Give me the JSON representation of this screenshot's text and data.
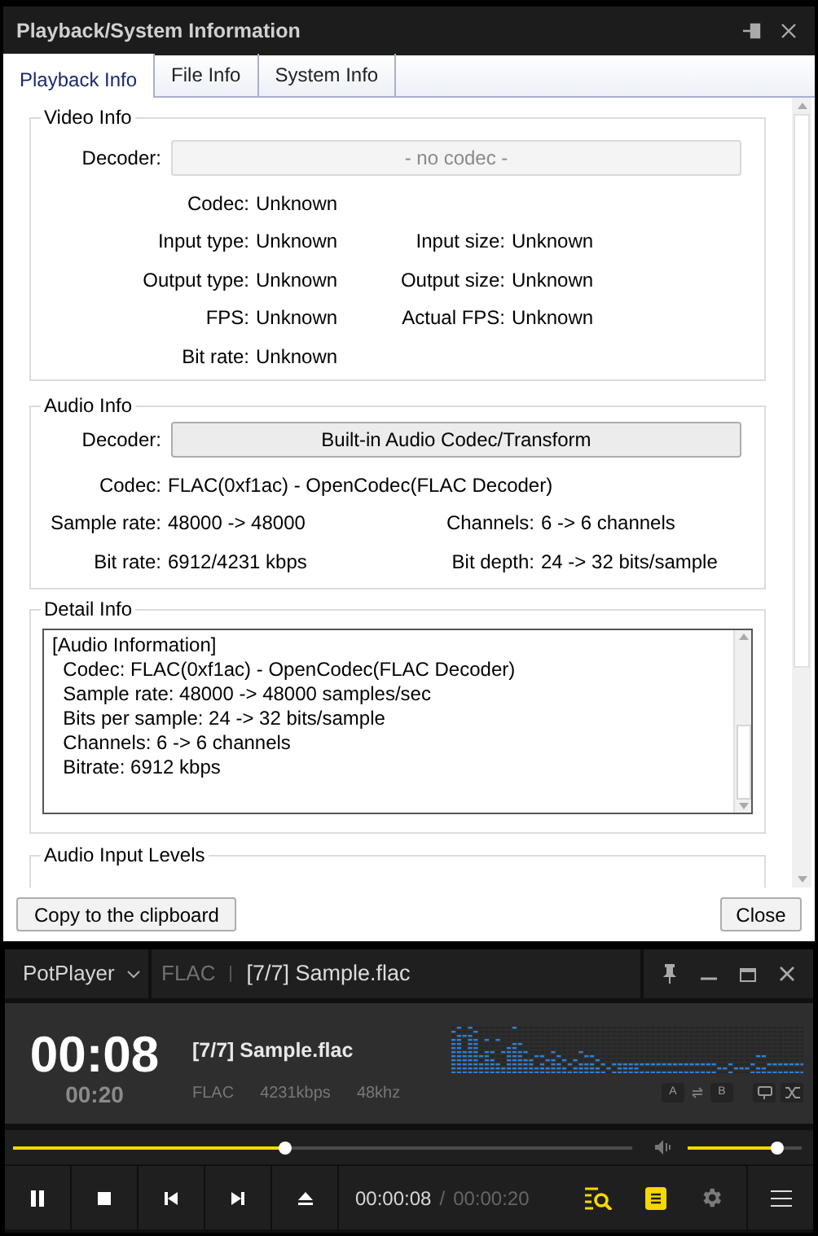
{
  "dialog": {
    "title": "Playback/System Information",
    "tabs": [
      {
        "label": "Playback Info",
        "selected": true
      },
      {
        "label": "File Info",
        "selected": false
      },
      {
        "label": "System Info",
        "selected": false
      }
    ],
    "video_info": {
      "title": "Video Info",
      "decoder_label": "Decoder:",
      "decoder_value": "- no codec -",
      "decoder_disabled": true,
      "rows": [
        {
          "left": {
            "label": "Codec:",
            "value": "Unknown"
          }
        },
        {
          "left": {
            "label": "Input type:",
            "value": "Unknown"
          },
          "right": {
            "label": "Input size:",
            "value": "Unknown"
          }
        },
        {
          "left": {
            "label": "Output type:",
            "value": "Unknown"
          },
          "right": {
            "label": "Output size:",
            "value": "Unknown"
          }
        },
        {
          "left": {
            "label": "FPS:",
            "value": "Unknown"
          },
          "right": {
            "label": "Actual FPS:",
            "value": "Unknown"
          }
        },
        {
          "left": {
            "label": "Bit rate:",
            "value": "Unknown"
          }
        }
      ]
    },
    "audio_info": {
      "title": "Audio Info",
      "decoder_label": "Decoder:",
      "decoder_value": "Built-in Audio Codec/Transform",
      "decoder_disabled": false,
      "rows": [
        {
          "left": {
            "label": "Codec:",
            "value": "FLAC(0xf1ac) - OpenCodec(FLAC Decoder)"
          }
        },
        {
          "left": {
            "label": "Sample rate:",
            "value": "48000 -> 48000"
          },
          "right": {
            "label": "Channels:",
            "value": "6 -> 6 channels"
          }
        },
        {
          "left": {
            "label": "Bit rate:",
            "value": "6912/4231 kbps"
          },
          "right": {
            "label": "Bit depth:",
            "value": "24 -> 32 bits/sample"
          }
        }
      ]
    },
    "detail_info": {
      "title": "Detail Info",
      "lines": [
        "[Audio Information]",
        "  Codec: FLAC(0xf1ac) - OpenCodec(FLAC Decoder)",
        "  Sample rate: 48000 -> 48000 samples/sec",
        "  Bits per sample: 24 -> 32 bits/sample",
        "  Channels: 6 -> 6 channels",
        "  Bitrate: 6912 kbps"
      ]
    },
    "audio_input_levels": {
      "title": "Audio Input Levels"
    },
    "copy_button": "Copy to the clipboard",
    "close_button": "Close"
  },
  "player": {
    "app_menu": "PotPlayer",
    "format": "FLAC",
    "title": "[7/7] Sample.flac",
    "elapsed": "00:08",
    "total": "00:20",
    "track_title": "[7/7] Sample.flac",
    "meta": [
      "FLAC",
      "4231kbps",
      "48khz"
    ],
    "ab_buttons": [
      "A",
      "B"
    ],
    "seek": {
      "level": 0.44
    },
    "volume": {
      "level": 0.79
    },
    "time_current": "00:00:08",
    "time_separator": "/",
    "time_total": "00:00:20",
    "tools": [
      {
        "kind": "playlist-search",
        "on": true
      },
      {
        "kind": "playlist",
        "on": true
      },
      {
        "kind": "settings",
        "on": false
      }
    ]
  }
}
